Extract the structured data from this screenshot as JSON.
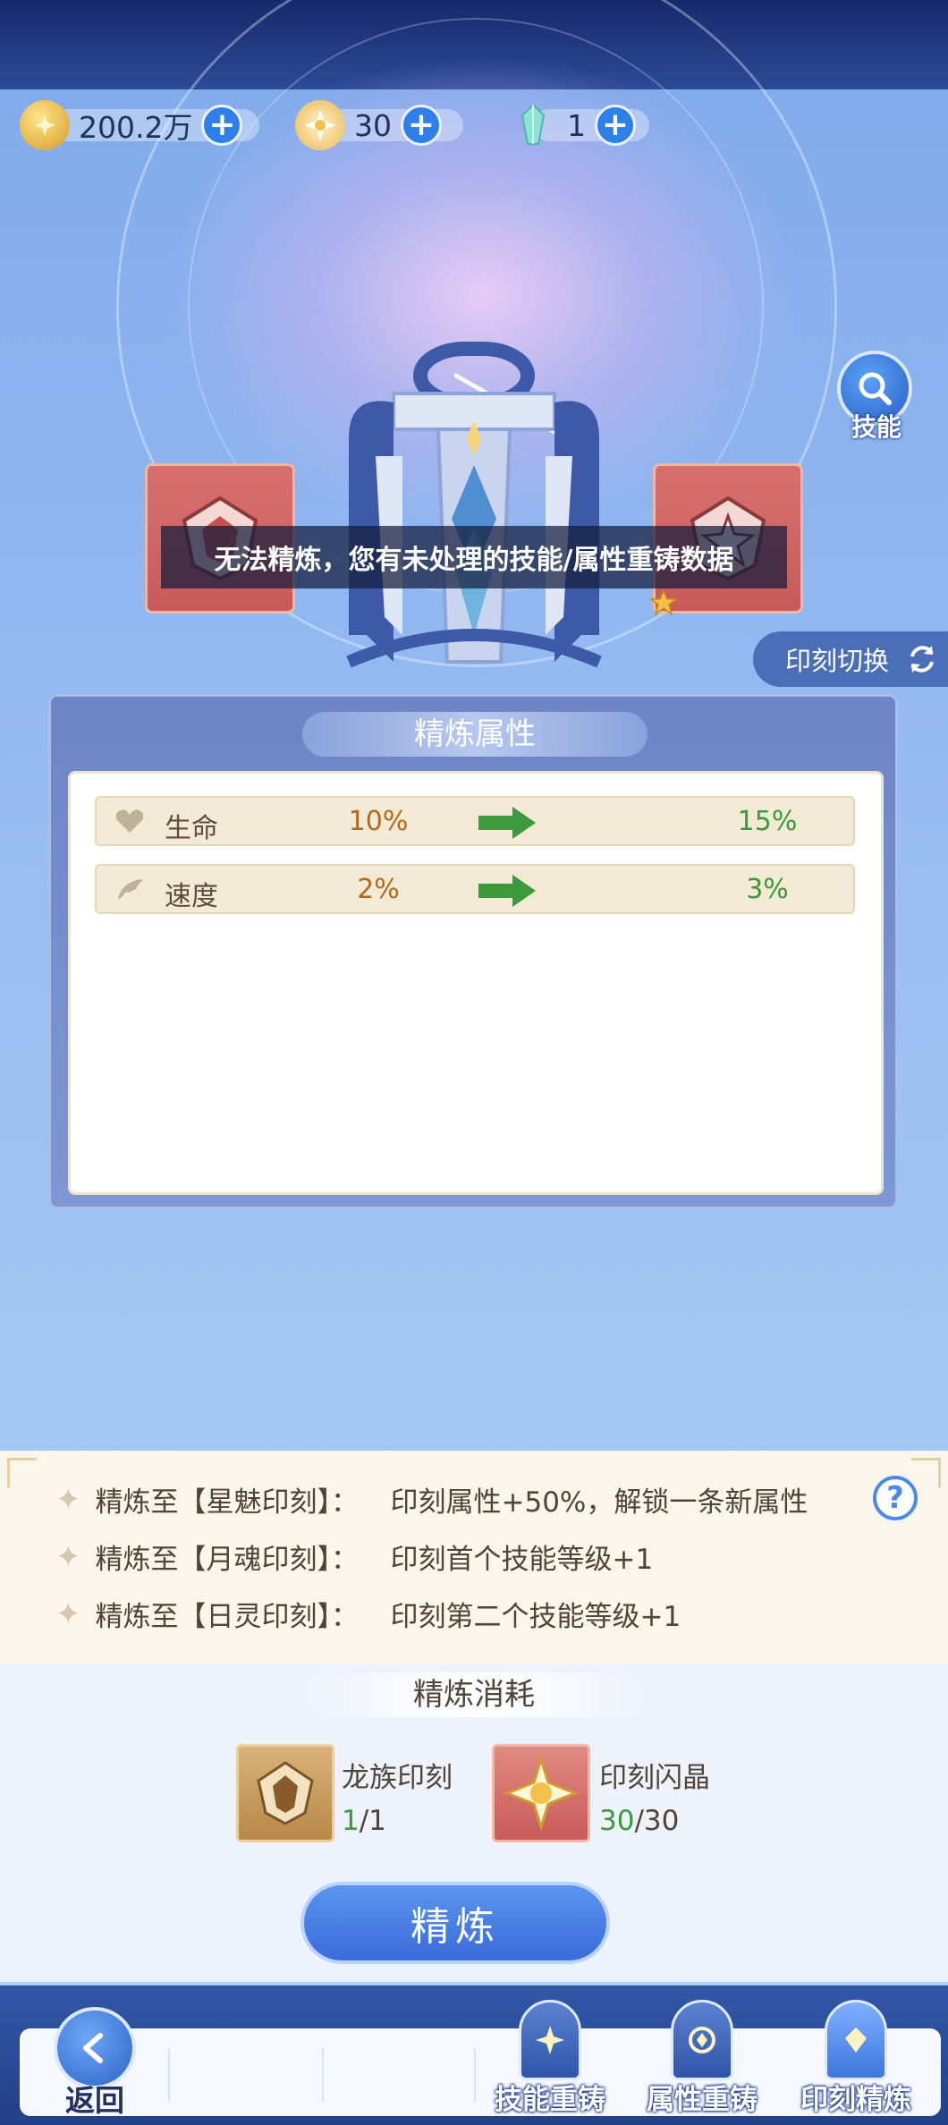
{
  "currency": [
    {
      "icon": "gold-coin-icon",
      "value": "200.2万"
    },
    {
      "icon": "star-badge-icon",
      "value": "30"
    },
    {
      "icon": "crystal-icon",
      "value": "1"
    }
  ],
  "skill_button": {
    "label": "技能"
  },
  "toast": "无法精炼，您有未处理的技能/属性重铸数据",
  "imprint_switch": {
    "label": "印刻切换"
  },
  "refine_panel": {
    "title": "精炼属性",
    "rows": [
      {
        "icon": "heart-icon",
        "name": "生命",
        "old": "10%",
        "new": "15%"
      },
      {
        "icon": "wing-icon",
        "name": "速度",
        "old": "2%",
        "new": "3%"
      }
    ]
  },
  "descriptions": [
    {
      "target": "精炼至【星魅印刻】：",
      "effect": "印刻属性+50%，解锁一条新属性"
    },
    {
      "target": "精炼至【月魂印刻】：",
      "effect": "印刻首个技能等级+1"
    },
    {
      "target": "精炼至【日灵印刻】：",
      "effect": "印刻第二个技能等级+1"
    }
  ],
  "cost": {
    "title": "精炼消耗",
    "items": [
      {
        "name": "龙族印刻",
        "have": "1",
        "need": "/1"
      },
      {
        "name": "印刻闪晶",
        "have": "30",
        "need": "/30"
      }
    ]
  },
  "refine_button": "精炼",
  "nav": {
    "back": "返回",
    "tabs": [
      "技能重铸",
      "属性重铸",
      "印刻精炼"
    ],
    "active": "印刻精炼"
  },
  "colors": {
    "accent_blue": "#3a6bd9",
    "increase_green": "#3b9a3b",
    "old_value_orange": "#b26a1a"
  }
}
